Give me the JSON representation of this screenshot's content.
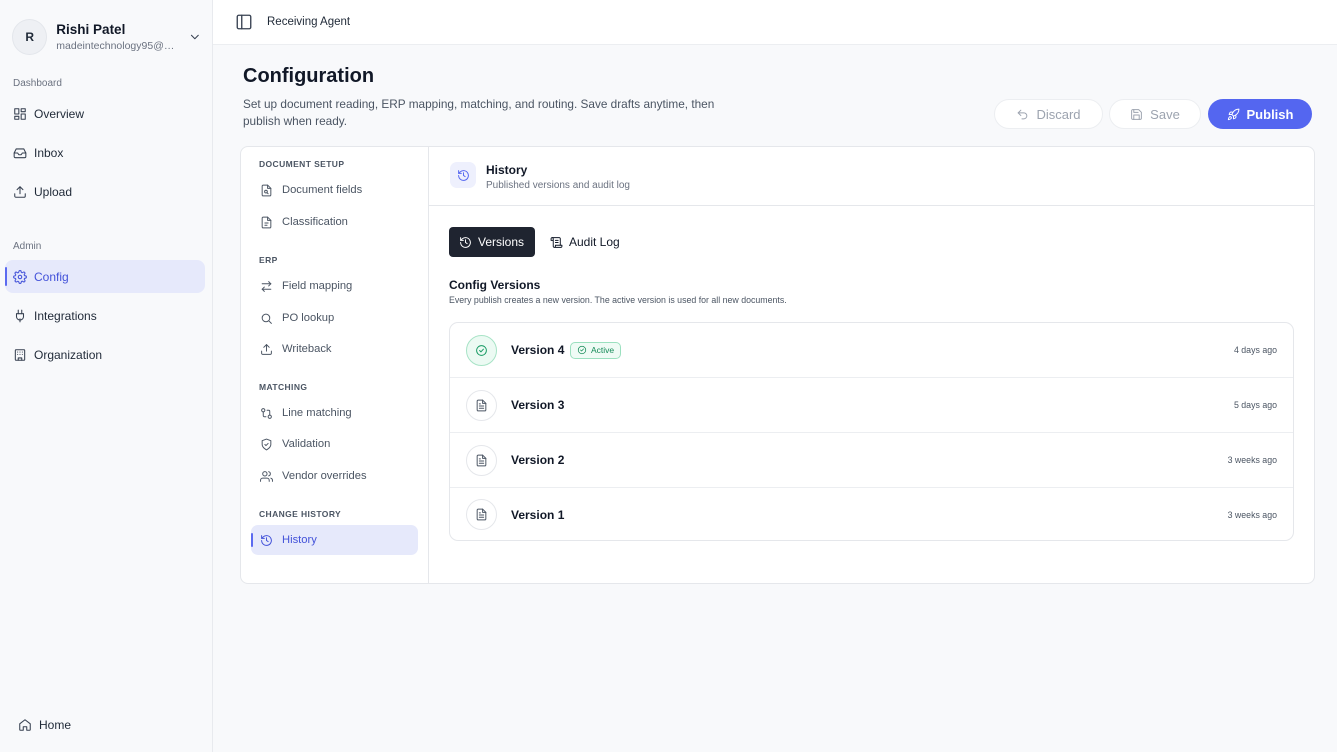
{
  "user": {
    "initial": "R",
    "name": "Rishi Patel",
    "email": "madeintechnology95@gmail.com"
  },
  "sidebar": {
    "sections": [
      {
        "label": "Dashboard",
        "items": [
          {
            "label": "Overview",
            "icon": "grid-icon"
          },
          {
            "label": "Inbox",
            "icon": "inbox-icon"
          },
          {
            "label": "Upload",
            "icon": "upload-icon"
          }
        ]
      },
      {
        "label": "Admin",
        "items": [
          {
            "label": "Config",
            "icon": "gear-icon",
            "active": true
          },
          {
            "label": "Integrations",
            "icon": "plug-icon"
          },
          {
            "label": "Organization",
            "icon": "building-icon"
          }
        ]
      }
    ],
    "home": {
      "label": "Home",
      "icon": "home-icon"
    }
  },
  "topbar": {
    "breadcrumb": "Receiving Agent",
    "icon": "panel-toggle-icon"
  },
  "header": {
    "title": "Configuration",
    "description": "Set up document reading, ERP mapping, matching, and routing. Save drafts anytime, then publish when ready.",
    "discard_label": "Discard",
    "save_label": "Save",
    "publish_label": "Publish"
  },
  "config_nav": {
    "sections": [
      {
        "label": "DOCUMENT SETUP",
        "items": [
          {
            "label": "Document fields",
            "icon": "file-search-icon"
          },
          {
            "label": "Classification",
            "icon": "file-tag-icon"
          }
        ]
      },
      {
        "label": "ERP",
        "items": [
          {
            "label": "Field mapping",
            "icon": "arrows-swap-icon"
          },
          {
            "label": "PO lookup",
            "icon": "search-icon"
          },
          {
            "label": "Writeback",
            "icon": "upload-icon"
          }
        ]
      },
      {
        "label": "MATCHING",
        "items": [
          {
            "label": "Line matching",
            "icon": "git-compare-icon"
          },
          {
            "label": "Validation",
            "icon": "shield-check-icon"
          },
          {
            "label": "Vendor overrides",
            "icon": "users-icon"
          }
        ]
      },
      {
        "label": "CHANGE HISTORY",
        "items": [
          {
            "label": "History",
            "icon": "history-icon",
            "active": true
          }
        ]
      }
    ]
  },
  "history": {
    "title": "History",
    "subtitle": "Published versions and audit log",
    "tabs": [
      {
        "label": "Versions",
        "active": true
      },
      {
        "label": "Audit Log",
        "active": false
      }
    ],
    "section_title": "Config Versions",
    "section_subtitle": "Every publish creates a new version. The active version is used for all new documents.",
    "active_badge": "Active",
    "versions": [
      {
        "name": "Version 4",
        "time": "4 days ago",
        "active": true
      },
      {
        "name": "Version 3",
        "time": "5 days ago",
        "active": false
      },
      {
        "name": "Version 2",
        "time": "3 weeks ago",
        "active": false
      },
      {
        "name": "Version 1",
        "time": "3 weeks ago",
        "active": false
      }
    ]
  },
  "colors": {
    "accent": "#5466f0",
    "active_green": "#179a63",
    "dark_tab": "#1f2430"
  }
}
